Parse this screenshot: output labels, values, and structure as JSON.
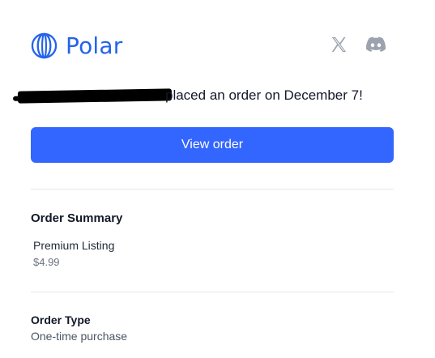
{
  "brand": {
    "name": "Polar",
    "color": "#2563eb"
  },
  "socials": [
    {
      "icon": "x-icon"
    },
    {
      "icon": "discord-icon"
    }
  ],
  "headline": {
    "text": "placed an order on December 7!"
  },
  "cta": {
    "label": "View order",
    "color": "#3366ff"
  },
  "summary": {
    "title": "Order Summary",
    "item": {
      "name": "Premium Listing",
      "price": "$4.99"
    }
  },
  "order_type": {
    "title": "Order Type",
    "value": "One-time purchase"
  }
}
